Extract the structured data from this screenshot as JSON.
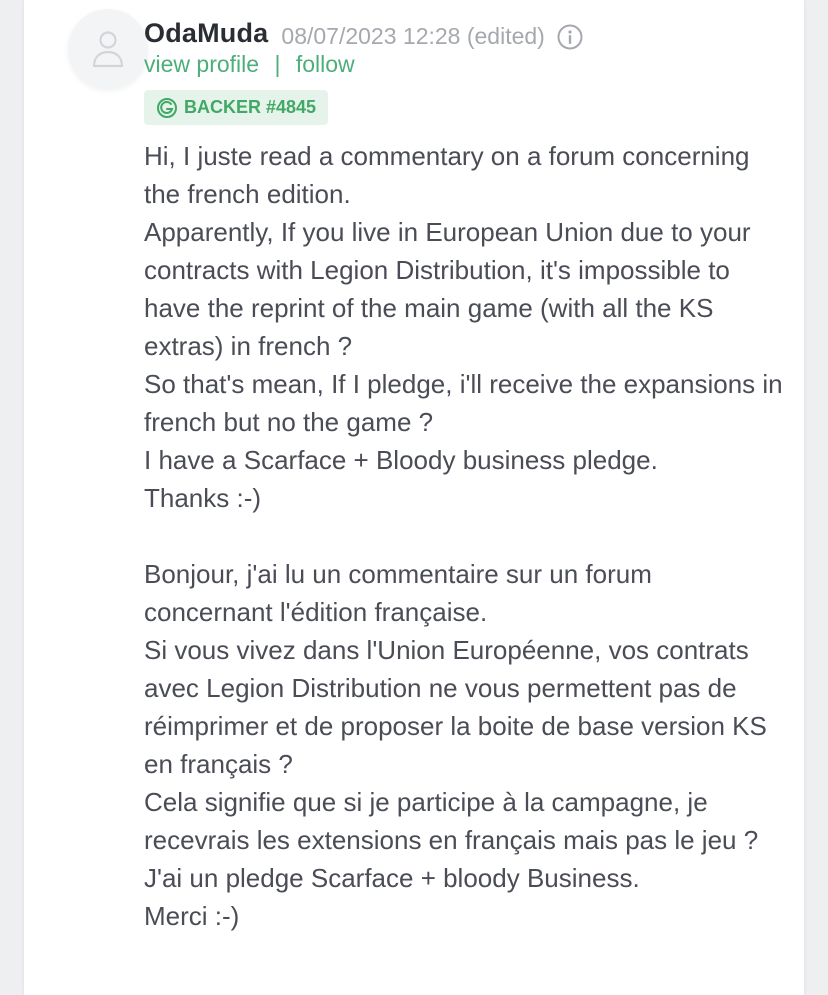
{
  "comment": {
    "username": "OdaMuda",
    "timestamp": "08/07/2023 12:28 (edited)",
    "links": {
      "view_profile": "view profile",
      "separator": "|",
      "follow": "follow"
    },
    "badge": "BACKER #4845",
    "body_lines": [
      "Hi, I juste read a commentary on a forum concerning the french edition.",
      "Apparently, If you live in European Union due to your contracts with Legion Distribution, it's impossible to have the reprint of the main game (with all the KS extras) in french ?",
      "So that's mean, If I pledge, i'll receive the expansions in french but no the game ?",
      "I have a Scarface + Bloody business pledge.",
      "Thanks :-)",
      "",
      "Bonjour, j'ai lu un commentaire sur un forum concernant l'édition française.",
      "Si vous vivez dans l'Union Européenne, vos contrats avec Legion Distribution ne vous permettent pas de réimprimer et de proposer la boite de base version KS en français ?",
      "Cela signifie que si je participe à la campagne, je recevrais les extensions en français mais pas le jeu ?",
      "J'ai un pledge Scarface + bloody Business.",
      "Merci :-)"
    ]
  },
  "icons": {
    "avatar": "user-placeholder-icon",
    "info": "info-icon",
    "badge": "backer-logo-icon"
  },
  "colors": {
    "accent_green": "#4caf7a",
    "badge_bg": "#e5f3ea",
    "text": "#4a4d55",
    "muted": "#a5a8ae"
  }
}
